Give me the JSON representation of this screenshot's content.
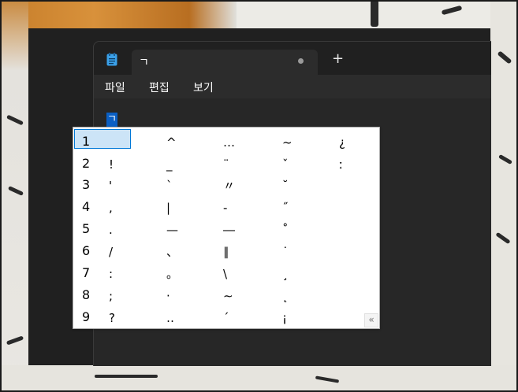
{
  "window": {
    "tab_title": "ㄱ",
    "new_tab": "+",
    "menu": [
      "파일",
      "편집",
      "보기"
    ],
    "editor_text": "ㄱ"
  },
  "ime": {
    "numbers": [
      "1",
      "2",
      "3",
      "4",
      "5",
      "6",
      "7",
      "8",
      "9"
    ],
    "columns": [
      [
        "",
        "!",
        "'",
        ",",
        ".",
        "/",
        ":",
        ";",
        "?"
      ],
      [
        "^",
        "_",
        "`",
        "|",
        "—",
        "、",
        "。",
        "·",
        "‥"
      ],
      [
        "…",
        "¨",
        "〃",
        "-",
        "―",
        "∥",
        "\\",
        "∼",
        "´"
      ],
      [
        "~",
        "ˇ",
        "˘",
        "˝",
        "˚",
        "˙",
        "¸",
        "˛",
        "¡"
      ],
      [
        "¿",
        "ː",
        "",
        "",
        "",
        "",
        "",
        "",
        ""
      ]
    ],
    "expand_glyph": "«"
  },
  "colors": {
    "selection_blue": "#0a5fc4",
    "candidate_highlight": "#cce4f7",
    "candidate_border": "#0078d7"
  }
}
